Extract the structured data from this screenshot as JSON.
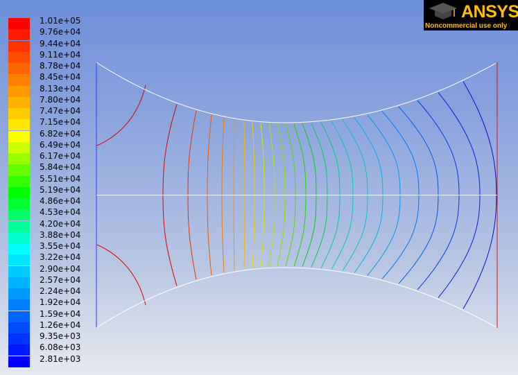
{
  "logo": {
    "brand": "ANSYS",
    "subtitle": "Noncommercial use only"
  },
  "legend": {
    "items": [
      {
        "label": "1.01e+05",
        "color": "#ff0000"
      },
      {
        "label": "9.76e+04",
        "color": "#ff1a00"
      },
      {
        "label": "9.44e+04",
        "color": "#ff3300"
      },
      {
        "label": "9.11e+04",
        "color": "#ff4d00"
      },
      {
        "label": "8.78e+04",
        "color": "#ff6600"
      },
      {
        "label": "8.45e+04",
        "color": "#ff8000"
      },
      {
        "label": "8.13e+04",
        "color": "#ff9900"
      },
      {
        "label": "7.80e+04",
        "color": "#ffb300"
      },
      {
        "label": "7.47e+04",
        "color": "#ffcc00"
      },
      {
        "label": "7.15e+04",
        "color": "#ffe600"
      },
      {
        "label": "6.82e+04",
        "color": "#ffff00"
      },
      {
        "label": "6.49e+04",
        "color": "#ccff00"
      },
      {
        "label": "6.17e+04",
        "color": "#99ff00"
      },
      {
        "label": "5.84e+04",
        "color": "#66ff00"
      },
      {
        "label": "5.51e+04",
        "color": "#33ff00"
      },
      {
        "label": "5.19e+04",
        "color": "#00ff00"
      },
      {
        "label": "4.86e+04",
        "color": "#00ff33"
      },
      {
        "label": "4.53e+04",
        "color": "#00ff66"
      },
      {
        "label": "4.20e+04",
        "color": "#00ff99"
      },
      {
        "label": "3.88e+04",
        "color": "#00ffcc"
      },
      {
        "label": "3.55e+04",
        "color": "#00ffff"
      },
      {
        "label": "3.22e+04",
        "color": "#00e6ff"
      },
      {
        "label": "2.90e+04",
        "color": "#00ccff"
      },
      {
        "label": "2.57e+04",
        "color": "#00b3ff"
      },
      {
        "label": "2.24e+04",
        "color": "#0099ff"
      },
      {
        "label": "1.92e+04",
        "color": "#0080ff"
      },
      {
        "label": "1.59e+04",
        "color": "#0066ff"
      },
      {
        "label": "1.26e+04",
        "color": "#004dff"
      },
      {
        "label": "9.35e+03",
        "color": "#0033ff"
      },
      {
        "label": "6.08e+03",
        "color": "#001aff"
      },
      {
        "label": "2.81e+03",
        "color": "#0000ff"
      }
    ]
  },
  "contour_colors": [
    "#dd0000",
    "#e83300",
    "#ee5a00",
    "#f07a00",
    "#f09a00",
    "#eeb800",
    "#e6d200",
    "#d0e400",
    "#aee600",
    "#86e400",
    "#55dd00",
    "#22d400",
    "#00cc22",
    "#00cc55",
    "#00cc88",
    "#00ccaa",
    "#00c4cc",
    "#00b4dd",
    "#0098e6",
    "#0078ea",
    "#0058e6",
    "#0038e0",
    "#0020d8",
    "#0010cc"
  ],
  "boundary_colors": {
    "inlet": "#2a3cff",
    "outlet": "#e01010",
    "wall": "#ffffff",
    "axis": "#ffffff"
  }
}
